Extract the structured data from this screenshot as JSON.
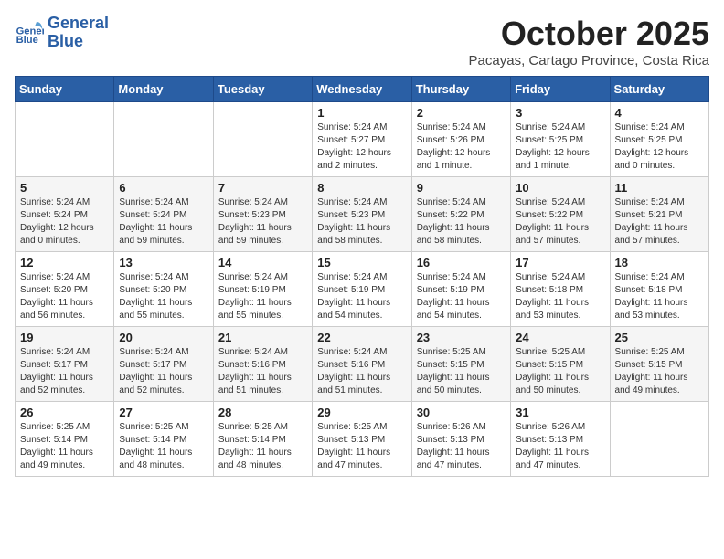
{
  "logo": {
    "line1": "General",
    "line2": "Blue"
  },
  "title": "October 2025",
  "subtitle": "Pacayas, Cartago Province, Costa Rica",
  "days_of_week": [
    "Sunday",
    "Monday",
    "Tuesday",
    "Wednesday",
    "Thursday",
    "Friday",
    "Saturday"
  ],
  "weeks": [
    [
      {
        "day": "",
        "info": ""
      },
      {
        "day": "",
        "info": ""
      },
      {
        "day": "",
        "info": ""
      },
      {
        "day": "1",
        "info": "Sunrise: 5:24 AM\nSunset: 5:27 PM\nDaylight: 12 hours\nand 2 minutes."
      },
      {
        "day": "2",
        "info": "Sunrise: 5:24 AM\nSunset: 5:26 PM\nDaylight: 12 hours\nand 1 minute."
      },
      {
        "day": "3",
        "info": "Sunrise: 5:24 AM\nSunset: 5:25 PM\nDaylight: 12 hours\nand 1 minute."
      },
      {
        "day": "4",
        "info": "Sunrise: 5:24 AM\nSunset: 5:25 PM\nDaylight: 12 hours\nand 0 minutes."
      }
    ],
    [
      {
        "day": "5",
        "info": "Sunrise: 5:24 AM\nSunset: 5:24 PM\nDaylight: 12 hours\nand 0 minutes."
      },
      {
        "day": "6",
        "info": "Sunrise: 5:24 AM\nSunset: 5:24 PM\nDaylight: 11 hours\nand 59 minutes."
      },
      {
        "day": "7",
        "info": "Sunrise: 5:24 AM\nSunset: 5:23 PM\nDaylight: 11 hours\nand 59 minutes."
      },
      {
        "day": "8",
        "info": "Sunrise: 5:24 AM\nSunset: 5:23 PM\nDaylight: 11 hours\nand 58 minutes."
      },
      {
        "day": "9",
        "info": "Sunrise: 5:24 AM\nSunset: 5:22 PM\nDaylight: 11 hours\nand 58 minutes."
      },
      {
        "day": "10",
        "info": "Sunrise: 5:24 AM\nSunset: 5:22 PM\nDaylight: 11 hours\nand 57 minutes."
      },
      {
        "day": "11",
        "info": "Sunrise: 5:24 AM\nSunset: 5:21 PM\nDaylight: 11 hours\nand 57 minutes."
      }
    ],
    [
      {
        "day": "12",
        "info": "Sunrise: 5:24 AM\nSunset: 5:20 PM\nDaylight: 11 hours\nand 56 minutes."
      },
      {
        "day": "13",
        "info": "Sunrise: 5:24 AM\nSunset: 5:20 PM\nDaylight: 11 hours\nand 55 minutes."
      },
      {
        "day": "14",
        "info": "Sunrise: 5:24 AM\nSunset: 5:19 PM\nDaylight: 11 hours\nand 55 minutes."
      },
      {
        "day": "15",
        "info": "Sunrise: 5:24 AM\nSunset: 5:19 PM\nDaylight: 11 hours\nand 54 minutes."
      },
      {
        "day": "16",
        "info": "Sunrise: 5:24 AM\nSunset: 5:19 PM\nDaylight: 11 hours\nand 54 minutes."
      },
      {
        "day": "17",
        "info": "Sunrise: 5:24 AM\nSunset: 5:18 PM\nDaylight: 11 hours\nand 53 minutes."
      },
      {
        "day": "18",
        "info": "Sunrise: 5:24 AM\nSunset: 5:18 PM\nDaylight: 11 hours\nand 53 minutes."
      }
    ],
    [
      {
        "day": "19",
        "info": "Sunrise: 5:24 AM\nSunset: 5:17 PM\nDaylight: 11 hours\nand 52 minutes."
      },
      {
        "day": "20",
        "info": "Sunrise: 5:24 AM\nSunset: 5:17 PM\nDaylight: 11 hours\nand 52 minutes."
      },
      {
        "day": "21",
        "info": "Sunrise: 5:24 AM\nSunset: 5:16 PM\nDaylight: 11 hours\nand 51 minutes."
      },
      {
        "day": "22",
        "info": "Sunrise: 5:24 AM\nSunset: 5:16 PM\nDaylight: 11 hours\nand 51 minutes."
      },
      {
        "day": "23",
        "info": "Sunrise: 5:25 AM\nSunset: 5:15 PM\nDaylight: 11 hours\nand 50 minutes."
      },
      {
        "day": "24",
        "info": "Sunrise: 5:25 AM\nSunset: 5:15 PM\nDaylight: 11 hours\nand 50 minutes."
      },
      {
        "day": "25",
        "info": "Sunrise: 5:25 AM\nSunset: 5:15 PM\nDaylight: 11 hours\nand 49 minutes."
      }
    ],
    [
      {
        "day": "26",
        "info": "Sunrise: 5:25 AM\nSunset: 5:14 PM\nDaylight: 11 hours\nand 49 minutes."
      },
      {
        "day": "27",
        "info": "Sunrise: 5:25 AM\nSunset: 5:14 PM\nDaylight: 11 hours\nand 48 minutes."
      },
      {
        "day": "28",
        "info": "Sunrise: 5:25 AM\nSunset: 5:14 PM\nDaylight: 11 hours\nand 48 minutes."
      },
      {
        "day": "29",
        "info": "Sunrise: 5:25 AM\nSunset: 5:13 PM\nDaylight: 11 hours\nand 47 minutes."
      },
      {
        "day": "30",
        "info": "Sunrise: 5:26 AM\nSunset: 5:13 PM\nDaylight: 11 hours\nand 47 minutes."
      },
      {
        "day": "31",
        "info": "Sunrise: 5:26 AM\nSunset: 5:13 PM\nDaylight: 11 hours\nand 47 minutes."
      },
      {
        "day": "",
        "info": ""
      }
    ]
  ]
}
